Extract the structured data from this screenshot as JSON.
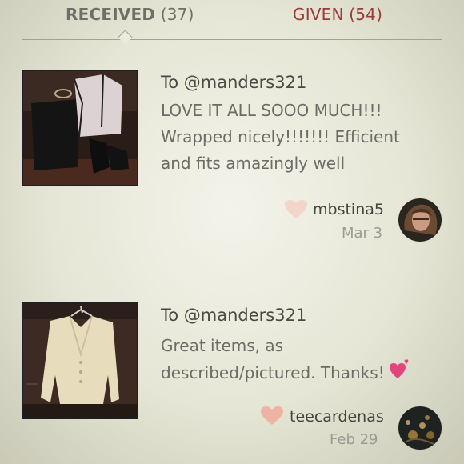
{
  "tabs": {
    "received_label": "RECEIVED",
    "received_count": "(37)",
    "given_label": "GIVEN",
    "given_count": "(54)"
  },
  "reviews": [
    {
      "to": "To @manders321",
      "message": "LOVE IT ALL SOOO MUCH!!! Wrapped nicely!!!!!!! Efficient and fits amazingly well",
      "username": "mbstina5",
      "date": "Mar 3"
    },
    {
      "to": "To @manders321",
      "message": "Great items, as described/pictured. Thanks!",
      "username": "teecardenas",
      "date": "Feb 29"
    }
  ],
  "colors": {
    "heart": "#f2c9bb",
    "heart_strong": "#e9a89a",
    "given": "#9a3a3a",
    "emoji_heart": "#e0457b"
  }
}
